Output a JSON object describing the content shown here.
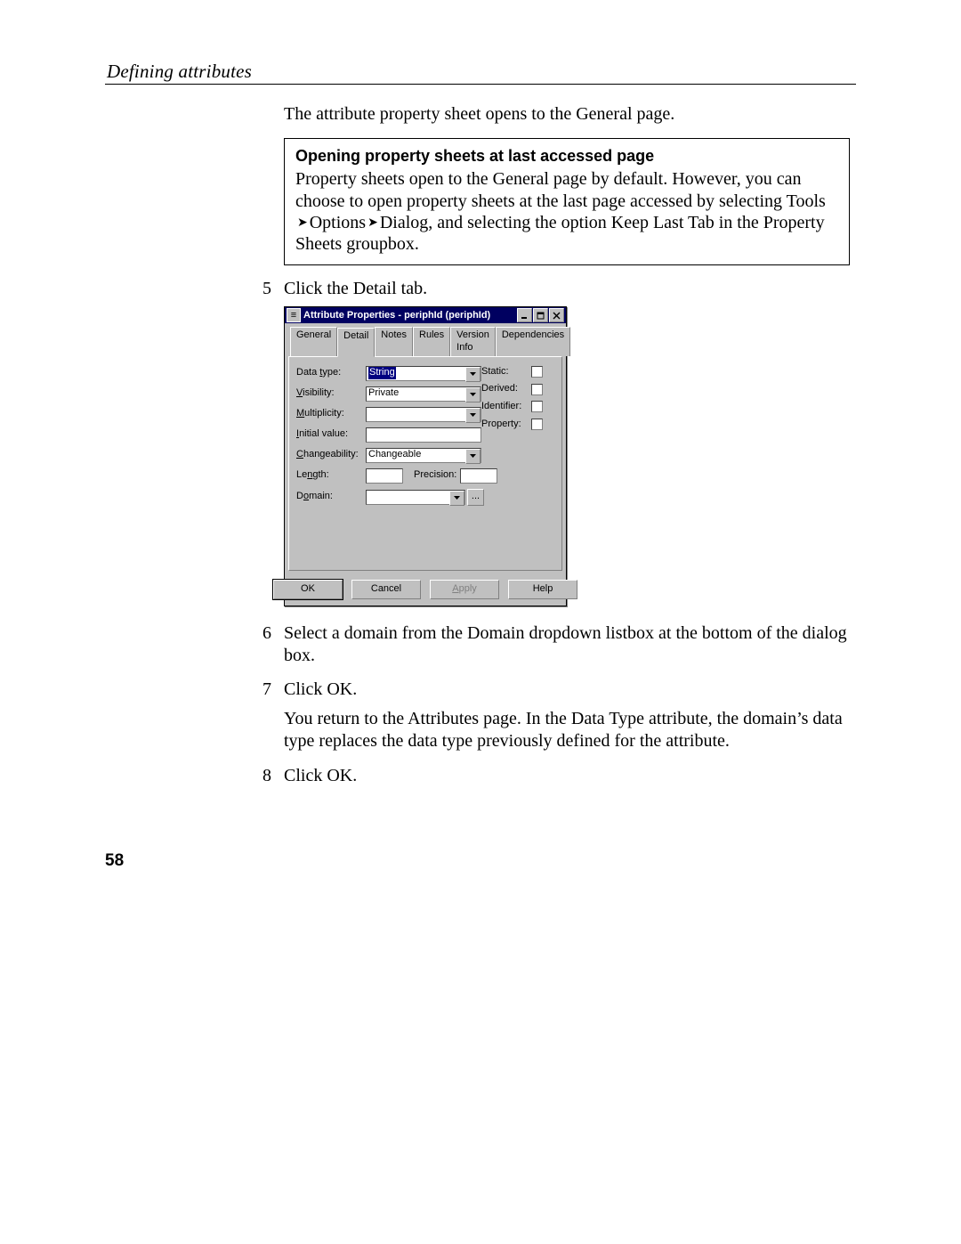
{
  "header": {
    "running_head": "Defining attributes",
    "page_number": "58"
  },
  "intro": {
    "text": "The attribute property sheet opens to the General page."
  },
  "note": {
    "title": "Opening property sheets at last accessed page",
    "seg1": "Property sheets open to the General page by default. However, you can choose to open property sheets at the last page accessed by selecting Tools",
    "menu_opt": "Options",
    "menu_dlg": "Dialog",
    "seg2": ", and selecting the option Keep Last Tab in the Property Sheets groupbox."
  },
  "steps": {
    "n5": "5",
    "t5": "Click the Detail tab.",
    "n6": "6",
    "t6": "Select a domain from the Domain dropdown listbox at the bottom of the dialog box.",
    "n7": "7",
    "t7": "Click OK.",
    "p7": "You return to the Attributes page. In the Data Type attribute, the domain’s data type replaces the data type previously defined for the attribute.",
    "n8": "8",
    "t8": "Click OK."
  },
  "dialog": {
    "title": "Attribute Properties - periphId (periphId)",
    "tabs": {
      "general": "General",
      "detail": "Detail",
      "notes": "Notes",
      "rules": "Rules",
      "version": "Version Info",
      "deps": "Dependencies"
    },
    "labels": {
      "datatype_pre": "Data ",
      "datatype_ul": "t",
      "datatype_post": "ype:",
      "visibility_ul": "V",
      "visibility_post": "isibility:",
      "multiplicity_ul": "M",
      "multiplicity_post": "ultiplicity:",
      "initial_ul": "I",
      "initial_post": "nitial value:",
      "change_ul": "C",
      "change_post": "hangeability:",
      "length_pre": "Le",
      "length_ul": "n",
      "length_post": "gth:",
      "precision_pre": "P",
      "precision_ul": "r",
      "precision_post": "ecision:",
      "domain_pre": "D",
      "domain_ul": "o",
      "domain_post": "main:",
      "static_ul": "S",
      "static_post": "tatic:",
      "derived_ul": "D",
      "derived_post": "erived:",
      "identifier_pre": "Identi",
      "identifier_ul": "f",
      "identifier_post": "ier:",
      "property_ul": "P",
      "property_post": "roperty:"
    },
    "values": {
      "datatype": "String",
      "visibility": "Private",
      "changeability": "Changeable"
    },
    "buttons": {
      "ok": "OK",
      "cancel": "Cancel",
      "apply_ul": "A",
      "apply_post": "pply",
      "help": "Help"
    },
    "ellipsis": "..."
  }
}
